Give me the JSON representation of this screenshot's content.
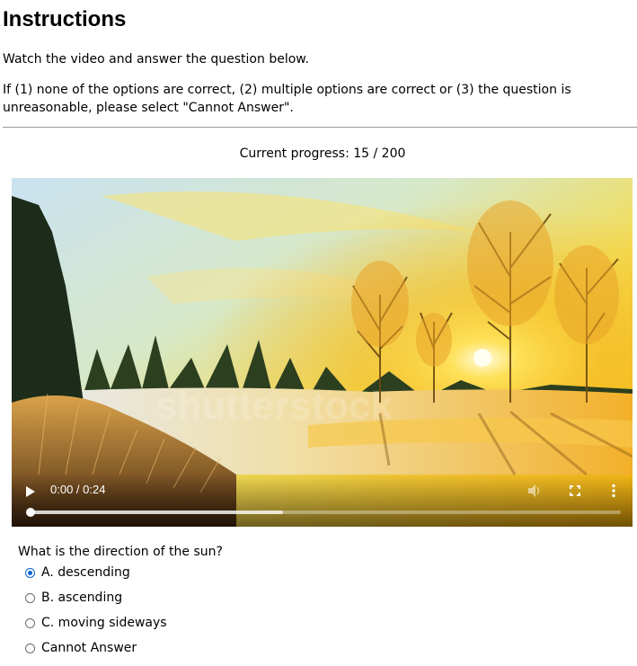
{
  "instructions": {
    "title": "Instructions",
    "line1": "Watch the video and answer the question below.",
    "line2": "If (1) none of the options are correct, (2) multiple options are correct or (3) the question is unreasonable, please select \"Cannot Answer\"."
  },
  "progress": {
    "text": "Current progress: 15 / 200",
    "current": 15,
    "total": 200
  },
  "video": {
    "time_display": "0:00 / 0:24",
    "watermark": "shutterstock",
    "played_fraction": 0.0,
    "buffered_fraction": 0.43,
    "icons": {
      "play": "play-icon",
      "mute": "volume-icon",
      "fullscreen": "fullscreen-icon",
      "more": "more-options-icon"
    }
  },
  "question": {
    "text": "What is the direction of the sun?",
    "options": [
      {
        "label": "A. descending",
        "selected": true
      },
      {
        "label": "B. ascending",
        "selected": false
      },
      {
        "label": "C. moving sideways",
        "selected": false
      },
      {
        "label": "Cannot Answer",
        "selected": false
      }
    ]
  },
  "colors": {
    "radio_selected": "#0a63d8",
    "divider": "#9a9a9a"
  }
}
